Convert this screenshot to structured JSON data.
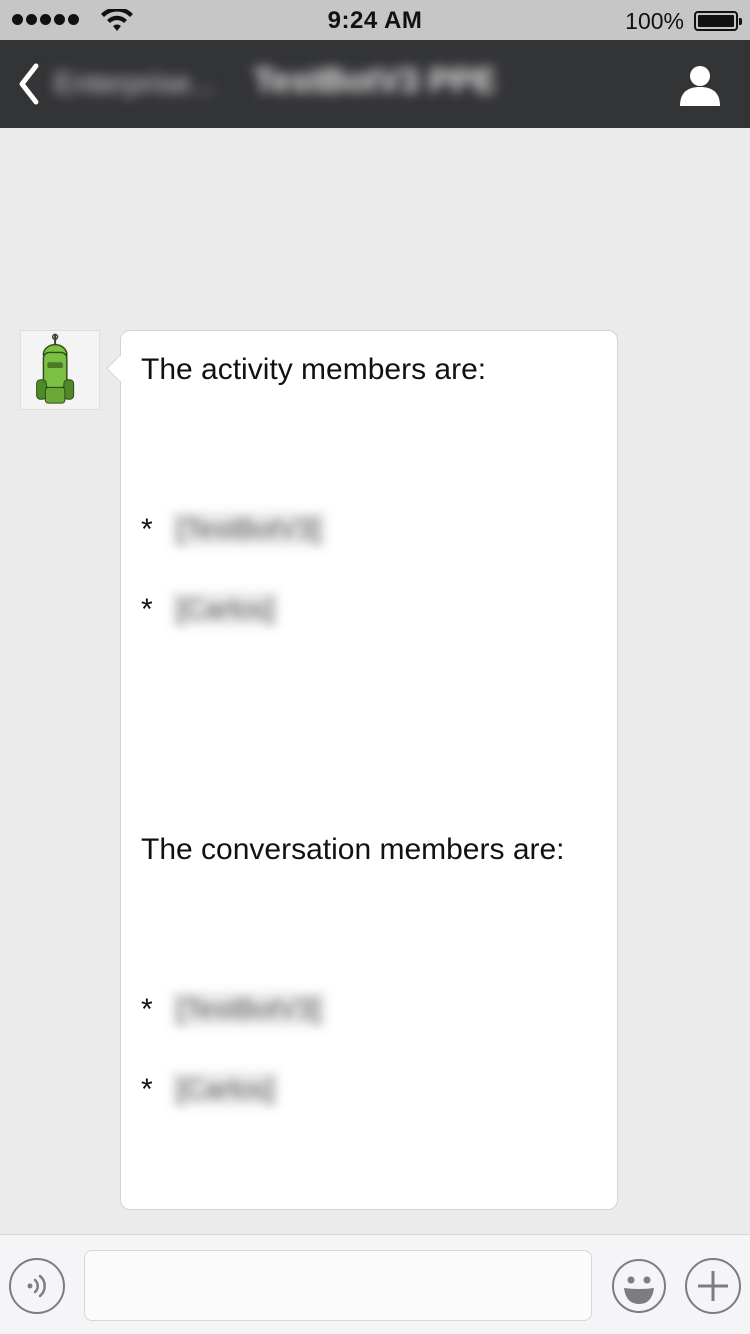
{
  "status_bar": {
    "time": "9:24 AM",
    "battery_percent": "100%",
    "signal_dots": 5,
    "icons": [
      "signal-dots-icon",
      "wifi-icon",
      "battery-icon"
    ]
  },
  "nav": {
    "back_label": "Enterprise...",
    "title": "TestBotV3 PPE",
    "icons": [
      "chevron-left-icon",
      "user-profile-icon"
    ]
  },
  "message": {
    "sender_avatar": "robot-avatar-icon",
    "activity_heading": "The activity members are:",
    "activity_members": [
      "[TestBotV3]",
      "[Carlos]"
    ],
    "conversation_heading": "The conversation members are:",
    "conversation_members": [
      "[TestBotV3]",
      "[Carlos]"
    ],
    "bullet": "*"
  },
  "input_bar": {
    "placeholder": "",
    "icons": [
      "voice-icon",
      "emoji-icon",
      "plus-icon"
    ]
  },
  "colors": {
    "nav_background": "#333436",
    "status_bar_background": "#c6c6c7",
    "chat_background": "#ebebeb",
    "bubble_background": "#ffffff",
    "avatar_green": "#7bc043"
  }
}
